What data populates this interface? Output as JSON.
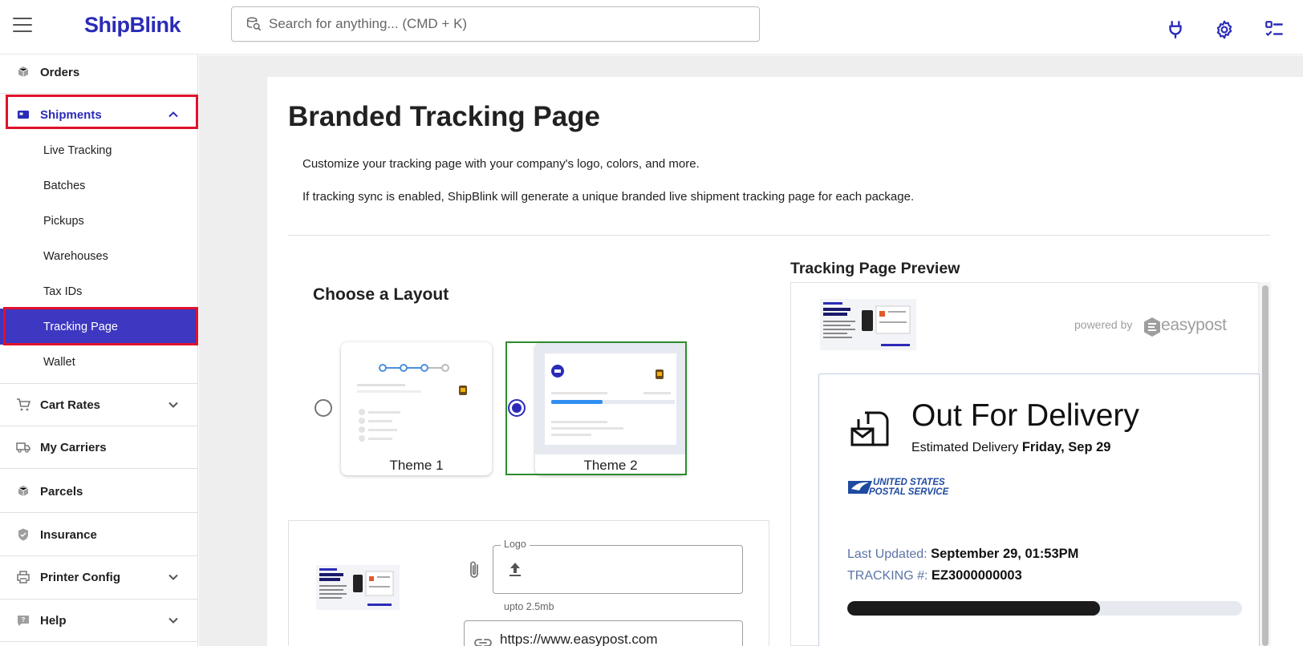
{
  "app": {
    "logo_text": "ShipBlink"
  },
  "search": {
    "placeholder": "Search for anything... (CMD + K)"
  },
  "topbar": {
    "icons": [
      "plug-icon",
      "gear-icon",
      "checklist-icon"
    ]
  },
  "sidebar": {
    "items": [
      {
        "label": "Orders",
        "icon": "orders-box-icon"
      },
      {
        "label": "Shipments",
        "icon": "shipment-icon",
        "expanded": true
      },
      {
        "label": "Cart Rates",
        "icon": "cart-icon"
      },
      {
        "label": "My Carriers",
        "icon": "truck-icon"
      },
      {
        "label": "Parcels",
        "icon": "parcel-icon"
      },
      {
        "label": "Insurance",
        "icon": "shield-icon"
      },
      {
        "label": "Printer Config",
        "icon": "printer-icon"
      },
      {
        "label": "Help",
        "icon": "help-icon"
      }
    ],
    "shipments_sub": [
      "Live Tracking",
      "Batches",
      "Pickups",
      "Warehouses",
      "Tax IDs",
      "Tracking Page",
      "Wallet"
    ],
    "active_sub": "Tracking Page"
  },
  "page": {
    "title": "Branded Tracking Page",
    "desc1": "Customize your tracking page with your company's logo, colors, and more.",
    "desc2": "If tracking sync is enabled, ShipBlink will generate a unique branded live shipment tracking page for each package."
  },
  "layout": {
    "title": "Choose a Layout",
    "themes": [
      {
        "label": "Theme 1",
        "selected": false
      },
      {
        "label": "Theme 2",
        "selected": true
      }
    ]
  },
  "upload": {
    "logo_label": "Logo",
    "helper": "upto 2.5mb",
    "url_value": "https://www.easypost.com"
  },
  "preview": {
    "title": "Tracking Page Preview",
    "powered_by": "powered by",
    "brand": "easypost",
    "status": "Out For Delivery",
    "est_label": "Estimated Delivery",
    "est_value": "Friday, Sep 29",
    "carrier_line1": "UNITED STATES",
    "carrier_line2": "POSTAL SERVICE",
    "updated_label": "Last Updated:",
    "updated_value": "September 29, 01:53PM",
    "tracking_label": "TRACKING #:",
    "tracking_value": "EZ3000000003",
    "progress_fraction": 0.64
  },
  "colors": {
    "brand": "#2b2bb8",
    "active_nav": "#3d37c1",
    "highlight": "#e0112b",
    "selected_theme": "#2e8b2e"
  }
}
